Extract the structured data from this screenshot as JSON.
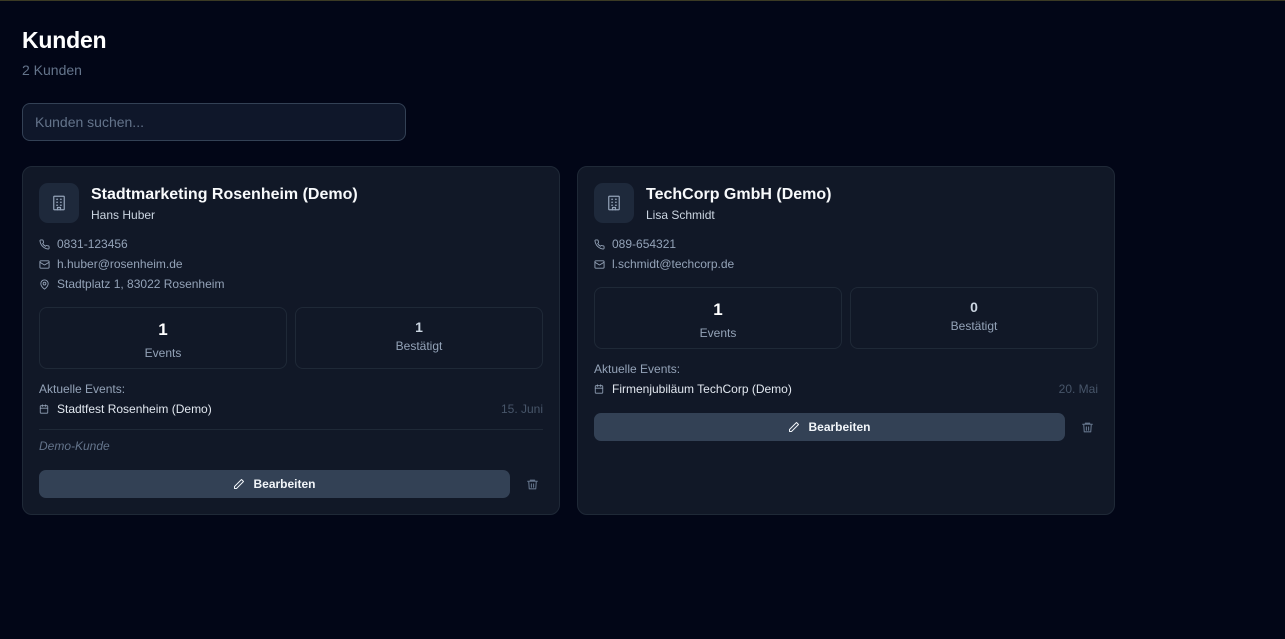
{
  "page": {
    "title": "Kunden",
    "subtitle": "2 Kunden"
  },
  "search": {
    "placeholder": "Kunden suchen..."
  },
  "customers": [
    {
      "name": "Stadtmarketing Rosenheim (Demo)",
      "contact": "Hans Huber",
      "phone": "0831-123456",
      "email": "h.huber@rosenheim.de",
      "address": "Stadtplatz 1, 83022 Rosenheim",
      "stats": {
        "events_value": "1",
        "events_label": "Events",
        "confirmed_value": "1",
        "confirmed_label": "Bestätigt"
      },
      "events_heading": "Aktuelle Events:",
      "events": [
        {
          "name": "Stadtfest Rosenheim (Demo)",
          "date": "15. Juni"
        }
      ],
      "note": "Demo-Kunde",
      "edit_label": "Bearbeiten"
    },
    {
      "name": "TechCorp GmbH (Demo)",
      "contact": "Lisa Schmidt",
      "phone": "089-654321",
      "email": "l.schmidt@techcorp.de",
      "stats": {
        "events_value": "1",
        "events_label": "Events",
        "confirmed_value": "0",
        "confirmed_label": "Bestätigt"
      },
      "events_heading": "Aktuelle Events:",
      "events": [
        {
          "name": "Firmenjubiläum TechCorp (Demo)",
          "date": "20. Mai"
        }
      ],
      "edit_label": "Bearbeiten"
    }
  ],
  "icons": {
    "avatar": "building-icon",
    "phone": "phone-icon",
    "email": "mail-icon",
    "address": "map-pin-icon",
    "event": "calendar-icon",
    "edit": "pencil-icon",
    "delete": "trash-icon"
  },
  "colors": {
    "background": "#020617",
    "card": "#111827",
    "button": "#334155"
  }
}
